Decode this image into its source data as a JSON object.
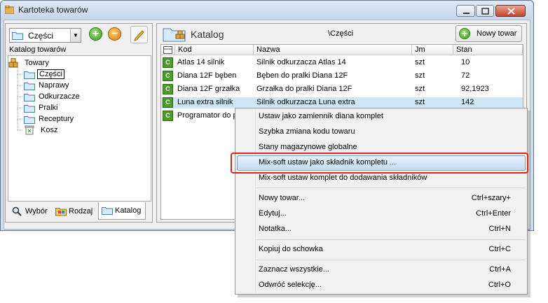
{
  "window": {
    "title": "Kartoteka towarów"
  },
  "left": {
    "combo_value": "Części",
    "catalog_label": "Katalog towarów",
    "tree": [
      {
        "label": "Towary",
        "level": 0
      },
      {
        "label": "Części",
        "level": 1
      },
      {
        "label": "Naprawy",
        "level": 1
      },
      {
        "label": "Odkurzacze",
        "level": 1
      },
      {
        "label": "Pralki",
        "level": 1
      },
      {
        "label": "Receptury",
        "level": 1
      },
      {
        "label": "Kosz",
        "level": 1
      }
    ],
    "tabs": {
      "wybor": "Wybór",
      "rodzaj": "Rodzaj",
      "katalog": "Katalog"
    }
  },
  "right": {
    "header_title": "Katalog",
    "header_path": "\\Części",
    "new_button": "Nowy towar",
    "columns": {
      "kod": "Kod",
      "nazwa": "Nazwa",
      "jm": "Jm",
      "stan": "Stan"
    },
    "rows": [
      {
        "kod": "Atlas 14 silnik",
        "nazwa": "Silnik odkurzacza Atlas 14",
        "jm": "szt",
        "stan": "10"
      },
      {
        "kod": "Diana 12F bęben",
        "nazwa": "Bęben do pralki Diana 12F",
        "jm": "szt",
        "stan": "72"
      },
      {
        "kod": "Diana 12F grzałka",
        "nazwa": "Grzałka do pralki Diana 12F",
        "jm": "szt",
        "stan": "92,1923"
      },
      {
        "kod": "Luna extra silnik",
        "nazwa": "Silnik odkurzacza Luna extra",
        "jm": "szt",
        "stan": "142"
      },
      {
        "kod": "Programator do p",
        "nazwa": "",
        "jm": "",
        "stan": ""
      }
    ]
  },
  "context_menu": {
    "items": [
      {
        "label": "Ustaw jako zamiennik diana komplet",
        "shortcut": ""
      },
      {
        "label": "Szybka zmiana kodu towaru",
        "shortcut": ""
      },
      {
        "label": "Stany magazynowe globalne",
        "shortcut": ""
      },
      {
        "label": "Mix-soft ustaw jako składnik kompletu ...",
        "shortcut": ""
      },
      {
        "label": "Mix-soft ustaw komplet do dodawania składników",
        "shortcut": ""
      },
      {
        "label": "Nowy towar...",
        "shortcut": "Ctrl+szary+"
      },
      {
        "label": "Edytuj...",
        "shortcut": "Ctrl+Enter"
      },
      {
        "label": "Notatka...",
        "shortcut": "Ctrl+N"
      },
      {
        "label": "Kopiuj do schowka",
        "shortcut": "Ctrl+C"
      },
      {
        "label": "Zaznacz wszystkie...",
        "shortcut": "Ctrl+A"
      },
      {
        "label": "Odwróć selekcję...",
        "shortcut": "Ctrl+O"
      }
    ]
  },
  "icons": [
    "app-icon",
    "folder-icon",
    "add-icon",
    "remove-icon",
    "pencil-icon",
    "towary-icon",
    "trash-icon",
    "magnifier-icon",
    "rodzaj-icon",
    "katalog-icon",
    "grid-icon",
    "c-item-icon"
  ],
  "colors": {
    "selection": "#cfe6f7",
    "menu_highlight": "#c4dcf3",
    "annotation_red": "#d9261c"
  }
}
